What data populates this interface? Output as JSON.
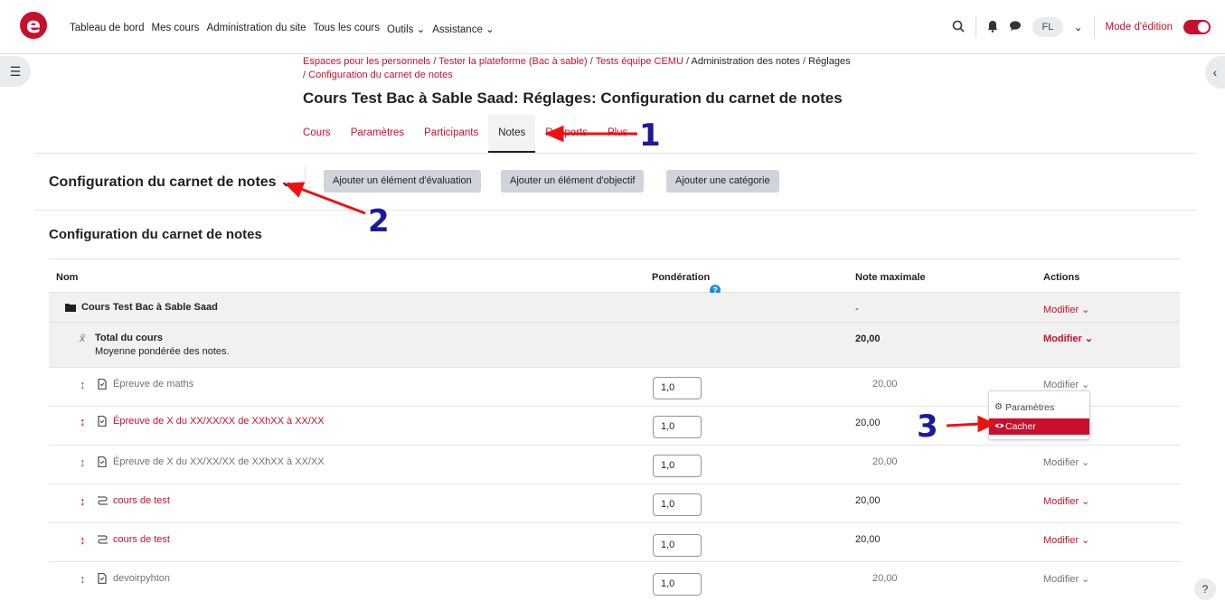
{
  "nav": {
    "menu": [
      "Tableau de bord",
      "Mes cours",
      "Administration du site",
      "Tous les cours",
      "Outils ⌄",
      "Assistance ⌄"
    ],
    "avatar": "FL",
    "edit_mode": "Mode d'édition"
  },
  "breadcrumb": {
    "items": [
      "Espaces pour les personnels",
      "Tester la plateforme (Bac à sable)",
      "Tests équipe CEMU",
      "Administration des notes",
      "Réglages",
      "Configuration du carnet de notes"
    ],
    "sep": "/"
  },
  "page_title": "Cours Test Bac à Sable Saad: Réglages: Configuration du carnet de notes",
  "tabs": [
    "Cours",
    "Paramètres",
    "Participants",
    "Notes",
    "Rapports",
    "Plus ⌄"
  ],
  "tertiary": {
    "title": "Configuration du carnet de notes ⌄",
    "buttons": [
      "Ajouter un élément d'évaluation",
      "Ajouter un élément d'objectif",
      "Ajouter une catégorie"
    ]
  },
  "section_title": "Configuration du carnet de notes",
  "table": {
    "headers": {
      "name": "Nom",
      "weight": "Pondération",
      "max": "Note maximale",
      "actions": "Actions"
    },
    "category": {
      "name": "Cours Test Bac à Sable Saad",
      "max": "-",
      "action": "Modifier ⌄"
    },
    "total": {
      "name": "Total du cours",
      "desc": "Moyenne pondérée des notes.",
      "max": "20,00",
      "action": "Modifier ⌄"
    },
    "rows": [
      {
        "name": "Épreuve de maths",
        "weight": "1,0",
        "max": "20,00",
        "action": "Modifier ⌄",
        "style": "muted",
        "icon": "file"
      },
      {
        "name": "Épreuve de X du XX/XX/XX de XXhXX à XX/XX",
        "weight": "1,0",
        "max": "20,00",
        "action": "",
        "style": "red",
        "icon": "file"
      },
      {
        "name": "Épreuve de X du XX/XX/XX de XXhXX à XX/XX",
        "weight": "1,0",
        "max": "20,00",
        "action": "Modifier ⌄",
        "style": "muted",
        "icon": "file"
      },
      {
        "name": "cours de test",
        "weight": "1,0",
        "max": "20,00",
        "action": "Modifier ⌄",
        "style": "red",
        "icon": "route"
      },
      {
        "name": "cours de test",
        "weight": "1,0",
        "max": "20,00",
        "action": "Modifier ⌄",
        "style": "red",
        "icon": "route"
      },
      {
        "name": "devoirpyhton",
        "weight": "1,0",
        "max": "20,00",
        "action": "Modifier ⌄",
        "style": "muted",
        "icon": "file"
      }
    ]
  },
  "dropdown": {
    "items": [
      "Paramètres",
      "Cacher"
    ]
  },
  "annotations": [
    "1",
    "2",
    "3"
  ],
  "help": "?",
  "colors": {
    "brand": "#c8102e",
    "annotation": "#1a1aa0"
  }
}
